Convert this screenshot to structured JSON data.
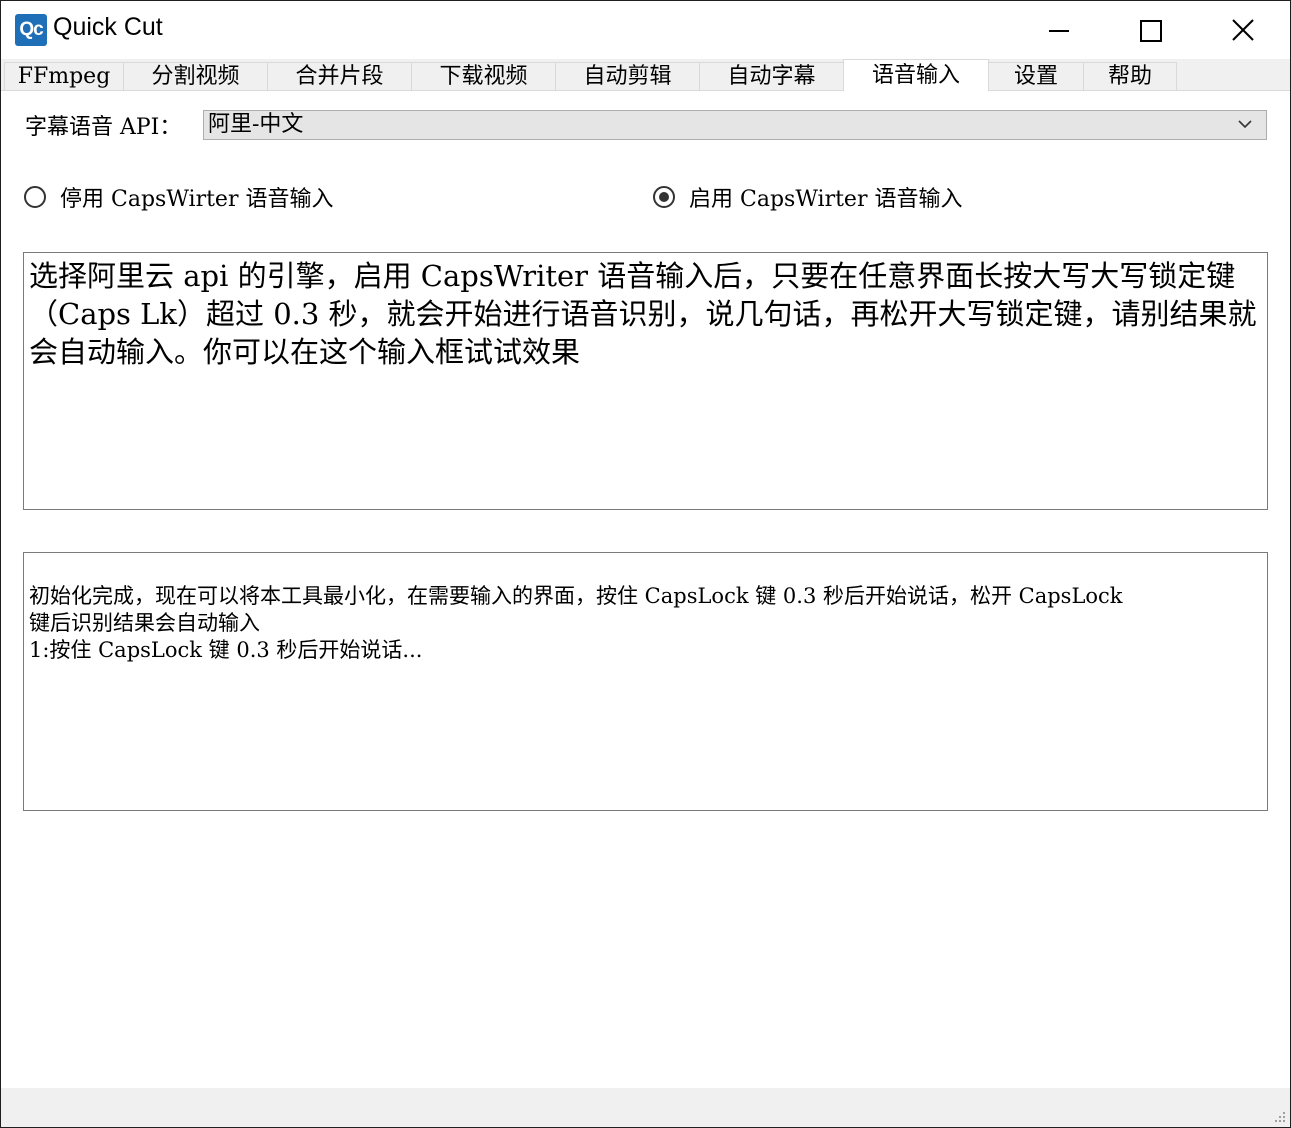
{
  "window": {
    "title": "Quick Cut",
    "icon_text": "Qc"
  },
  "tabs": [
    {
      "label": "FFmpeg"
    },
    {
      "label": "分割视频"
    },
    {
      "label": "合并片段"
    },
    {
      "label": "下载视频"
    },
    {
      "label": "自动剪辑"
    },
    {
      "label": "自动字幕"
    },
    {
      "label": "语音输入",
      "active": true
    },
    {
      "label": "设置"
    },
    {
      "label": "帮助"
    }
  ],
  "api": {
    "label": "字幕语音 API：",
    "selected": "阿里-中文"
  },
  "radios": {
    "disable": {
      "label": "停用 CapsWirter 语音输入",
      "checked": false
    },
    "enable": {
      "label": "启用 CapsWirter 语音输入",
      "checked": true
    }
  },
  "input_box": {
    "text": "选择阿里云 api 的引擎，启用 CapsWriter 语音输入后，只要在任意界面长按大写大写锁定键（Caps Lk）超过 0.3 秒，就会开始进行语音识别，说几句话，再松开大写锁定键，请别结果就会自动输入。你可以在这个输入框试试效果"
  },
  "log_box": {
    "lines": [
      "初始化完成，现在可以将本工具最小化，在需要输入的界面，按住 CapsLock 键 0.3 秒后开始说话，松开 CapsLock",
      "键后识别结果会自动输入",
      "1:按住 CapsLock 键 0.3 秒后开始说话..."
    ]
  },
  "colors": {
    "accent": "#1f6fb8",
    "tab_bg": "#f0f0f0",
    "select_bg": "#e5e5e5"
  }
}
